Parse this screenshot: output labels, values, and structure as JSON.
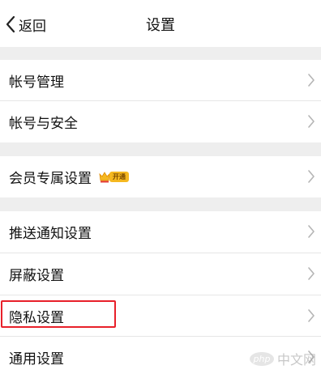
{
  "header": {
    "back_label": "返回",
    "title": "设置"
  },
  "settings": {
    "account_management": "帐号管理",
    "account_security": "帐号与安全",
    "member_settings": "会员专属设置",
    "member_badge": "开通",
    "push_settings": "推送通知设置",
    "block_settings": "屏蔽设置",
    "privacy_settings": "隐私设置",
    "general_settings": "通用设置"
  },
  "watermark": {
    "logo_text": "php",
    "site_text": "中文网"
  },
  "colors": {
    "section_gap": "#eeeeee",
    "highlight_border": "#e8202a",
    "badge": "#f5b820"
  },
  "icons": {
    "back": "chevron-left-icon",
    "row": "chevron-right-icon",
    "crown": "vip-crown-icon"
  }
}
